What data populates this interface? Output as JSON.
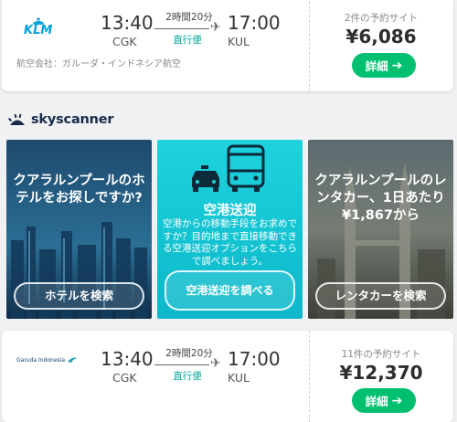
{
  "flight1": {
    "airline": "KLM",
    "dep_time": "13:40",
    "dep_code": "CGK",
    "duration": "2時間20分",
    "stops": "直行便",
    "arr_time": "17:00",
    "arr_code": "KUL",
    "operated_by": "航空会社：ガルーダ・インドネシア航空",
    "sites": "2件の予約サイト",
    "price": "¥6,086",
    "button": "詳細"
  },
  "sponsor": {
    "brand": "skyscanner"
  },
  "panels": [
    {
      "text": "クアラルンプールのホテルをお探しですか?",
      "button": "ホテルを検索"
    },
    {
      "title": "空港送迎",
      "desc": "空港からの移動手段をお求めですか？目的地まで直接移動できる空港送迎オプションをこちらで調べましょう。",
      "button": "空港送迎を調べる"
    },
    {
      "text": "クアラルンプールのレンタカー、1日あたり¥1,867から",
      "button": "レンタカーを検索"
    }
  ],
  "flight2": {
    "airline": "Garuda Indonesia",
    "dep_time": "13:40",
    "dep_code": "CGK",
    "duration": "2時間20分",
    "stops": "直行便",
    "arr_time": "17:00",
    "arr_code": "KUL",
    "sites": "11件の予約サイト",
    "price": "¥12,370",
    "button": "詳細"
  },
  "colors": {
    "accent_green": "#00c06f",
    "direct_teal": "#00a698",
    "klm_blue": "#00a1de"
  }
}
